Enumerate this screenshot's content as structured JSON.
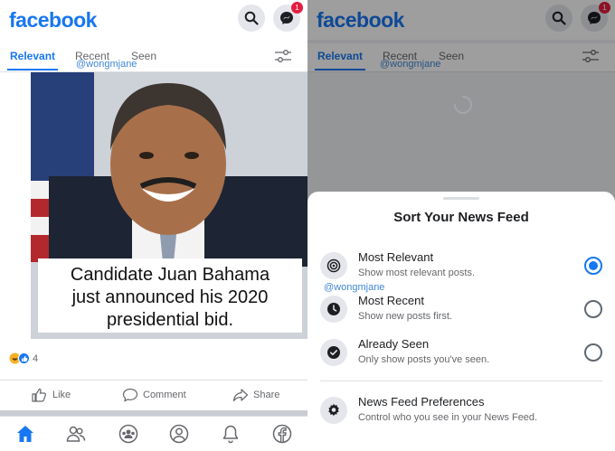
{
  "left": {
    "header": {
      "logo": "facebook",
      "messenger_badge": "1"
    },
    "tabs": [
      "Relevant",
      "Recent",
      "Seen"
    ],
    "watermark": "@wongmjane",
    "post": {
      "caption_lines": [
        "Candidate Juan Bahama",
        "just announced his 2020",
        "presidential bid."
      ],
      "reaction_count": "4",
      "actions": {
        "like": "Like",
        "comment": "Comment",
        "share": "Share"
      }
    },
    "bottom_nav": [
      "home-icon",
      "friends-icon",
      "groups-icon",
      "profile-icon",
      "notifications-icon",
      "facebook-icon"
    ]
  },
  "right": {
    "header": {
      "logo": "facebook",
      "messenger_badge": "1"
    },
    "tabs": [
      "Relevant",
      "Recent",
      "Seen"
    ],
    "watermark": "@wongmjane",
    "sheet": {
      "title": "Sort Your News Feed",
      "watermark": "@wongmjane",
      "options": [
        {
          "label": "Most Relevant",
          "desc": "Show most relevant posts.",
          "selected": true,
          "icon": "target-icon"
        },
        {
          "label": "Most Recent",
          "desc": "Show new posts first.",
          "selected": false,
          "icon": "clock-icon"
        },
        {
          "label": "Already Seen",
          "desc": "Only show posts you've seen.",
          "selected": false,
          "icon": "check-circle-icon"
        }
      ],
      "preferences": {
        "label": "News Feed Preferences",
        "desc": "Control who you see in your News Feed.",
        "icon": "gear-icon"
      }
    }
  },
  "colors": {
    "brand": "#1877f2",
    "badge": "#e41e3f"
  }
}
